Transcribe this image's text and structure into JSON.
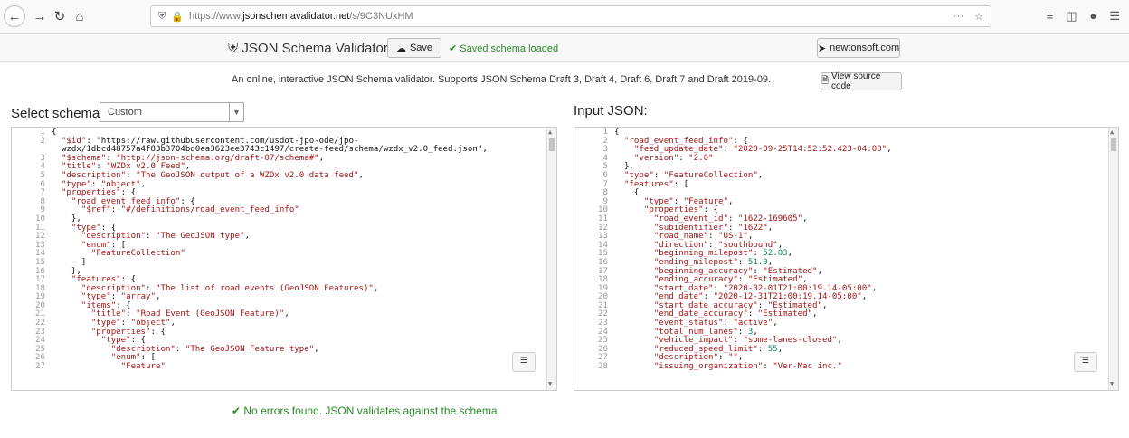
{
  "browser": {
    "url_prefix": "https://www.",
    "url_domain": "jsonschemavalidator.net",
    "url_path": "/s/9C3NUxHM",
    "more": "···"
  },
  "toolbar": {
    "app_title": "JSON Schema Validator",
    "save_label": "Save",
    "saved_status": "Saved schema loaded",
    "newtonsoft_label": "newtonsoft.com"
  },
  "description": "An online, interactive JSON Schema validator. Supports JSON Schema Draft 3, Draft 4, Draft 6, Draft 7 and Draft 2019-09.",
  "view_source_label": "View source code",
  "schema_panel": {
    "label": "Select schema:",
    "selected": "Custom",
    "lines": [
      "{",
      "  \"$id\": \"https://raw.githubusercontent.com/usdot-jpo-ode/jpo-",
      "  wzdx/1dbcd48757a4f83b3704bd0ea3623ee3743c1497/create-feed/schema/wzdx_v2.0_feed.json\",",
      "  \"$schema\": \"http://json-schema.org/draft-07/schema#\",",
      "  \"title\": \"WZDx v2.0 Feed\",",
      "  \"description\": \"The GeoJSON output of a WZDx v2.0 data feed\",",
      "  \"type\": \"object\",",
      "  \"properties\": {",
      "    \"road_event_feed_info\": {",
      "      \"$ref\": \"#/definitions/road_event_feed_info\"",
      "    },",
      "    \"type\": {",
      "      \"description\": \"The GeoJSON type\",",
      "      \"enum\": [",
      "        \"FeatureCollection\"",
      "      ]",
      "    },",
      "    \"features\": {",
      "      \"description\": \"The list of road events (GeoJSON Features)\",",
      "      \"type\": \"array\",",
      "      \"items\": {",
      "        \"title\": \"Road Event (GeoJSON Feature)\",",
      "        \"type\": \"object\",",
      "        \"properties\": {",
      "          \"type\": {",
      "            \"description\": \"The GeoJSON Feature type\",",
      "            \"enum\": [",
      "              \"Feature\""
    ],
    "line_numbers": [
      "1",
      "2",
      "",
      "3",
      "4",
      "5",
      "6",
      "7",
      "8",
      "9",
      "10",
      "11",
      "12",
      "13",
      "14",
      "15",
      "16",
      "17",
      "18",
      "19",
      "20",
      "21",
      "22",
      "23",
      "24",
      "25",
      "26",
      "27"
    ]
  },
  "input_panel": {
    "label": "Input JSON:",
    "lines": [
      "{",
      "  \"road_event_feed_info\": {",
      "    \"feed_update_date\": \"2020-09-25T14:52:52.423-04:00\",",
      "    \"version\": \"2.0\"",
      "  },",
      "  \"type\": \"FeatureCollection\",",
      "  \"features\": [",
      "    {",
      "      \"type\": \"Feature\",",
      "      \"properties\": {",
      "        \"road_event_id\": \"1622-169605\",",
      "        \"subidentifier\": \"1622\",",
      "        \"road_name\": \"US-1\",",
      "        \"direction\": \"southbound\",",
      "        \"beginning_milepost\": 52.03,",
      "        \"ending_milepost\": 51.0,",
      "        \"beginning_accuracy\": \"Estimated\",",
      "        \"ending_accuracy\": \"Estimated\",",
      "        \"start_date\": \"2020-02-01T21:00:19.14-05:00\",",
      "        \"end_date\": \"2020-12-31T21:00:19.14-05:00\",",
      "        \"start_date_accuracy\": \"Estimated\",",
      "        \"end_date_accuracy\": \"Estimated\",",
      "        \"event_status\": \"active\",",
      "        \"total_num_lanes\": 3,",
      "        \"vehicle_impact\": \"some-lanes-closed\",",
      "        \"reduced_speed_limit\": 55,",
      "        \"description\": \"\",",
      "        \"issuing_organization\": \"Ver-Mac inc.\""
    ],
    "line_numbers": [
      "1",
      "2",
      "3",
      "4",
      "5",
      "6",
      "7",
      "8",
      "9",
      "10",
      "11",
      "12",
      "13",
      "14",
      "15",
      "16",
      "17",
      "18",
      "19",
      "20",
      "21",
      "22",
      "23",
      "24",
      "25",
      "26",
      "27",
      "28"
    ]
  },
  "result_message": "No errors found. JSON validates against the schema",
  "colors": {
    "success": "#2a8a2a",
    "string": "#a31515",
    "number": "#098658"
  },
  "icons": [
    "back-icon",
    "forward-icon",
    "reload-icon",
    "home-icon",
    "shield-icon",
    "lock-icon",
    "pocket-icon",
    "star-icon",
    "library-icon",
    "sidebar-icon",
    "extension-icon",
    "menu-icon",
    "shield-logo-icon",
    "cloud-upload-icon",
    "check-icon",
    "send-icon",
    "document-icon",
    "format-icon"
  ]
}
